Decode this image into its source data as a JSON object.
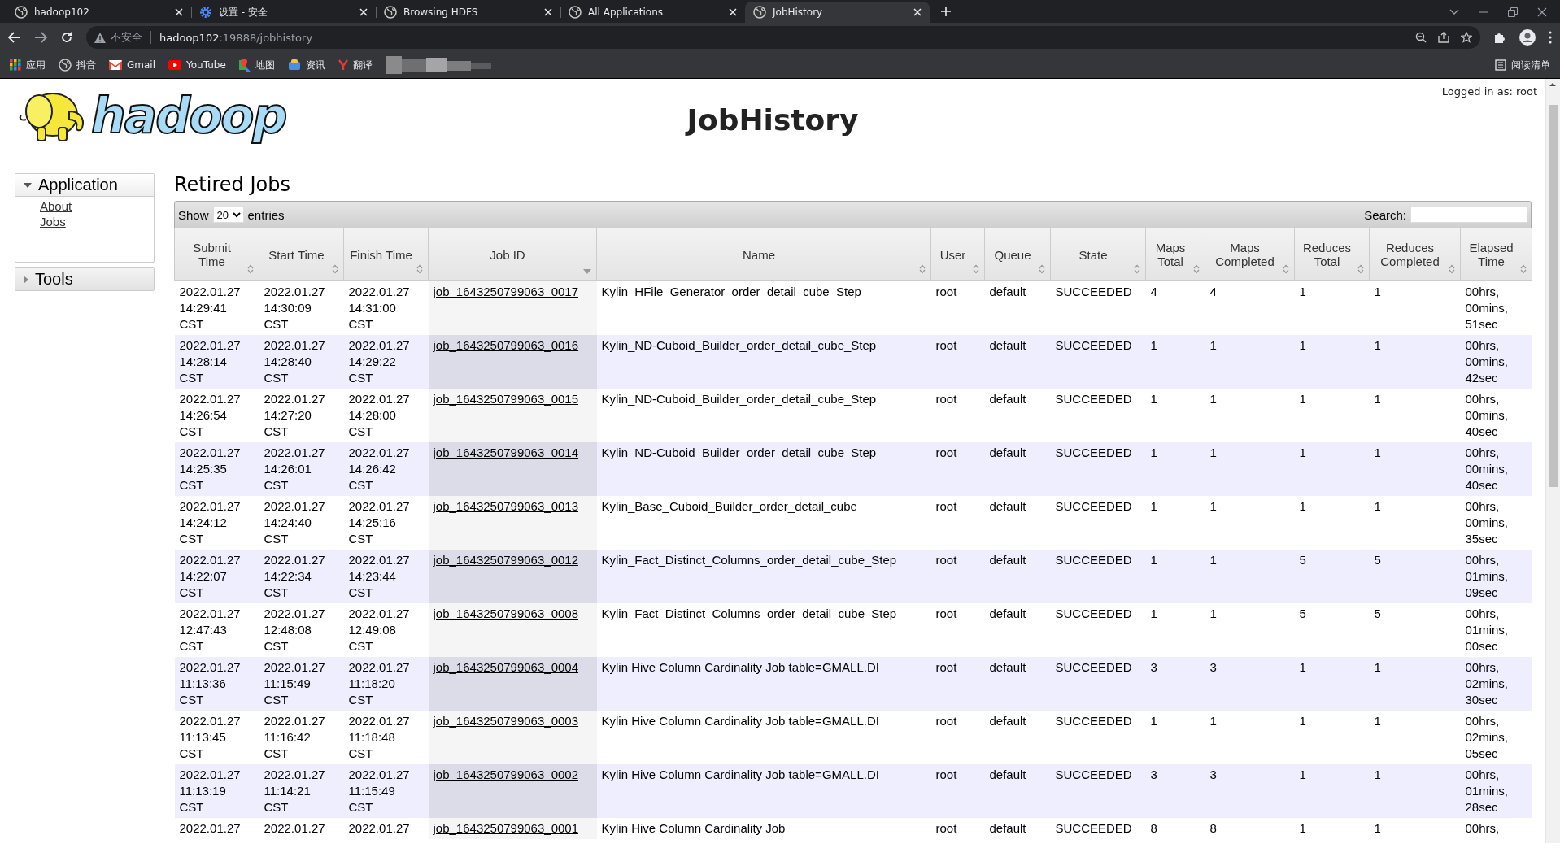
{
  "browser": {
    "tabs": [
      {
        "title": "hadoop102",
        "selected": false
      },
      {
        "title": "设置 - 安全",
        "selected": false
      },
      {
        "title": "Browsing HDFS",
        "selected": false
      },
      {
        "title": "All Applications",
        "selected": false
      },
      {
        "title": "JobHistory",
        "selected": true
      }
    ],
    "security": "不安全",
    "url_host": "hadoop102",
    "url_rest": ":19888/jobhistory",
    "bookmarks": [
      {
        "label": "应用"
      },
      {
        "label": "抖音"
      },
      {
        "label": "Gmail"
      },
      {
        "label": "YouTube"
      },
      {
        "label": "地图"
      },
      {
        "label": "资讯"
      },
      {
        "label": "翻译"
      }
    ],
    "reading_list": "阅读清单"
  },
  "page": {
    "logo_text": "hadoop",
    "title": "JobHistory",
    "login": "Logged in as: root",
    "sidebar": [
      {
        "label": "Application",
        "expanded": true,
        "links": [
          "About",
          "Jobs"
        ]
      },
      {
        "label": "Tools",
        "expanded": false
      }
    ],
    "section_title": "Retired Jobs",
    "toolbar": {
      "show": "Show",
      "page_size": "20",
      "entries": "entries",
      "search_label": "Search:"
    },
    "columns": [
      {
        "label": "Submit Time",
        "sorted": false
      },
      {
        "label": "Start Time",
        "sorted": false
      },
      {
        "label": "Finish Time",
        "sorted": false
      },
      {
        "label": "Job ID",
        "sorted": true
      },
      {
        "label": "Name",
        "sorted": false
      },
      {
        "label": "User",
        "sorted": false
      },
      {
        "label": "Queue",
        "sorted": false
      },
      {
        "label": "State",
        "sorted": false
      },
      {
        "label": "Maps Total",
        "sorted": false
      },
      {
        "label": "Maps Completed",
        "sorted": false
      },
      {
        "label": "Reduces Total",
        "sorted": false
      },
      {
        "label": "Reduces Completed",
        "sorted": false
      },
      {
        "label": "Elapsed Time",
        "sorted": false
      }
    ],
    "rows": [
      [
        "2022.01.27 14:29:41 CST",
        "2022.01.27 14:30:09 CST",
        "2022.01.27 14:31:00 CST",
        "job_1643250799063_0017",
        "Kylin_HFile_Generator_order_detail_cube_Step",
        "root",
        "default",
        "SUCCEEDED",
        "4",
        "4",
        "1",
        "1",
        "00hrs, 00mins, 51sec"
      ],
      [
        "2022.01.27 14:28:14 CST",
        "2022.01.27 14:28:40 CST",
        "2022.01.27 14:29:22 CST",
        "job_1643250799063_0016",
        "Kylin_ND-Cuboid_Builder_order_detail_cube_Step",
        "root",
        "default",
        "SUCCEEDED",
        "1",
        "1",
        "1",
        "1",
        "00hrs, 00mins, 42sec"
      ],
      [
        "2022.01.27 14:26:54 CST",
        "2022.01.27 14:27:20 CST",
        "2022.01.27 14:28:00 CST",
        "job_1643250799063_0015",
        "Kylin_ND-Cuboid_Builder_order_detail_cube_Step",
        "root",
        "default",
        "SUCCEEDED",
        "1",
        "1",
        "1",
        "1",
        "00hrs, 00mins, 40sec"
      ],
      [
        "2022.01.27 14:25:35 CST",
        "2022.01.27 14:26:01 CST",
        "2022.01.27 14:26:42 CST",
        "job_1643250799063_0014",
        "Kylin_ND-Cuboid_Builder_order_detail_cube_Step",
        "root",
        "default",
        "SUCCEEDED",
        "1",
        "1",
        "1",
        "1",
        "00hrs, 00mins, 40sec"
      ],
      [
        "2022.01.27 14:24:12 CST",
        "2022.01.27 14:24:40 CST",
        "2022.01.27 14:25:16 CST",
        "job_1643250799063_0013",
        "Kylin_Base_Cuboid_Builder_order_detail_cube",
        "root",
        "default",
        "SUCCEEDED",
        "1",
        "1",
        "1",
        "1",
        "00hrs, 00mins, 35sec"
      ],
      [
        "2022.01.27 14:22:07 CST",
        "2022.01.27 14:22:34 CST",
        "2022.01.27 14:23:44 CST",
        "job_1643250799063_0012",
        "Kylin_Fact_Distinct_Columns_order_detail_cube_Step",
        "root",
        "default",
        "SUCCEEDED",
        "1",
        "1",
        "5",
        "5",
        "00hrs, 01mins, 09sec"
      ],
      [
        "2022.01.27 12:47:43 CST",
        "2022.01.27 12:48:08 CST",
        "2022.01.27 12:49:08 CST",
        "job_1643250799063_0008",
        "Kylin_Fact_Distinct_Columns_order_detail_cube_Step",
        "root",
        "default",
        "SUCCEEDED",
        "1",
        "1",
        "5",
        "5",
        "00hrs, 01mins, 00sec"
      ],
      [
        "2022.01.27 11:13:36 CST",
        "2022.01.27 11:15:49 CST",
        "2022.01.27 11:18:20 CST",
        "job_1643250799063_0004",
        "Kylin Hive Column Cardinality Job table=GMALL.DI",
        "root",
        "default",
        "SUCCEEDED",
        "3",
        "3",
        "1",
        "1",
        "00hrs, 02mins, 30sec"
      ],
      [
        "2022.01.27 11:13:45 CST",
        "2022.01.27 11:16:42 CST",
        "2022.01.27 11:18:48 CST",
        "job_1643250799063_0003",
        "Kylin Hive Column Cardinality Job table=GMALL.DI",
        "root",
        "default",
        "SUCCEEDED",
        "1",
        "1",
        "1",
        "1",
        "00hrs, 02mins, 05sec"
      ],
      [
        "2022.01.27 11:13:19 CST",
        "2022.01.27 11:14:21 CST",
        "2022.01.27 11:15:49 CST",
        "job_1643250799063_0002",
        "Kylin Hive Column Cardinality Job table=GMALL.DI",
        "root",
        "default",
        "SUCCEEDED",
        "3",
        "3",
        "1",
        "1",
        "00hrs, 01mins, 28sec"
      ],
      [
        "2022.01.27",
        "2022.01.27",
        "2022.01.27",
        "job_1643250799063_0001",
        "Kylin Hive Column Cardinality Job",
        "root",
        "default",
        "SUCCEEDED",
        "8",
        "8",
        "1",
        "1",
        "00hrs,"
      ]
    ]
  }
}
